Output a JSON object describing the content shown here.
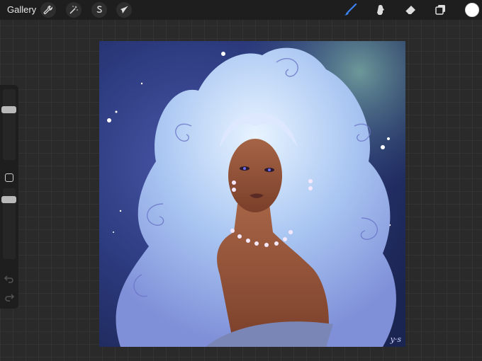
{
  "topbar": {
    "gallery_label": "Gallery",
    "left_tools": [
      {
        "icon": "wrench-icon",
        "name": "actions"
      },
      {
        "icon": "magic-wand-icon",
        "name": "adjustments"
      },
      {
        "icon": "selection-s-icon",
        "name": "selection"
      },
      {
        "icon": "arrow-cursor-icon",
        "name": "transform"
      }
    ],
    "right_tools": [
      {
        "icon": "brush-icon",
        "name": "brush",
        "active": true
      },
      {
        "icon": "smudge-icon",
        "name": "smudge"
      },
      {
        "icon": "eraser-icon",
        "name": "eraser"
      },
      {
        "icon": "layers-icon",
        "name": "layers"
      }
    ],
    "current_color": "#ffffff",
    "active_tool_color": "#3b82f6"
  },
  "sidebar": {
    "brush_size_slider": "size",
    "opacity_slider": "opacity",
    "undo_icon": "undo-icon",
    "redo_icon": "redo-icon"
  },
  "artwork": {
    "signature": "y·s"
  }
}
